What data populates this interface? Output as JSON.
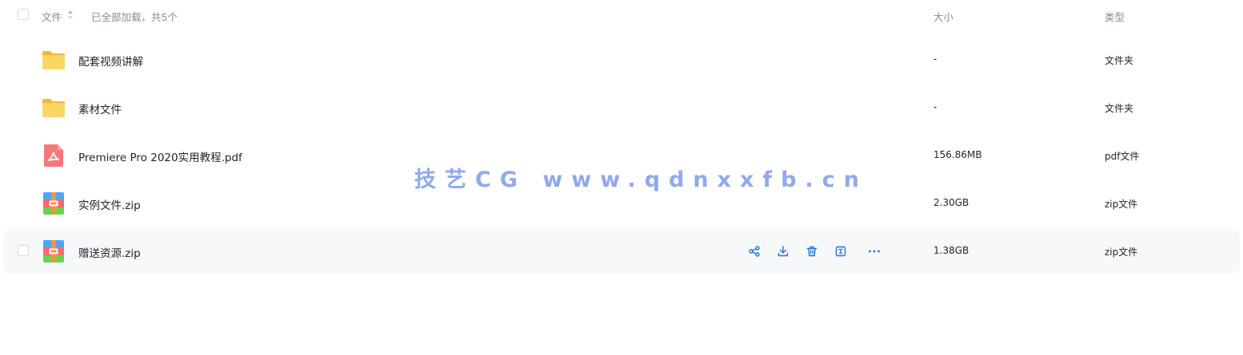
{
  "header": {
    "file_label": "文件",
    "loaded_status": "已全部加载，共5个",
    "size_label": "大小",
    "type_label": "类型"
  },
  "files": [
    {
      "name": "配套视频讲解",
      "size": "-",
      "type": "文件夹",
      "icon": "folder-icon"
    },
    {
      "name": "素材文件",
      "size": "-",
      "type": "文件夹",
      "icon": "folder-icon"
    },
    {
      "name": "Premiere Pro 2020实用教程.pdf",
      "size": "156.86MB",
      "type": "pdf文件",
      "icon": "pdf-file-icon"
    },
    {
      "name": "实例文件.zip",
      "size": "2.30GB",
      "type": "zip文件",
      "icon": "zip-file-icon"
    },
    {
      "name": "赠送资源.zip",
      "size": "1.38GB",
      "type": "zip文件",
      "icon": "zip-file-icon"
    }
  ],
  "row_actions": [
    "share-icon",
    "download-icon",
    "delete-icon",
    "rename-icon",
    "more-icon"
  ],
  "watermark": "技艺CG  www.qdnxxfb.cn",
  "colors": {
    "accent": "#1a73e8",
    "folder": "#fcc945",
    "pdf": "#f36b6f",
    "zip_blue": "#4fa6f5",
    "zip_green": "#6bd34a",
    "zip_orange": "#f7913d",
    "watermark": "#8fa8ef",
    "hover_row": "#f7f8fa"
  }
}
